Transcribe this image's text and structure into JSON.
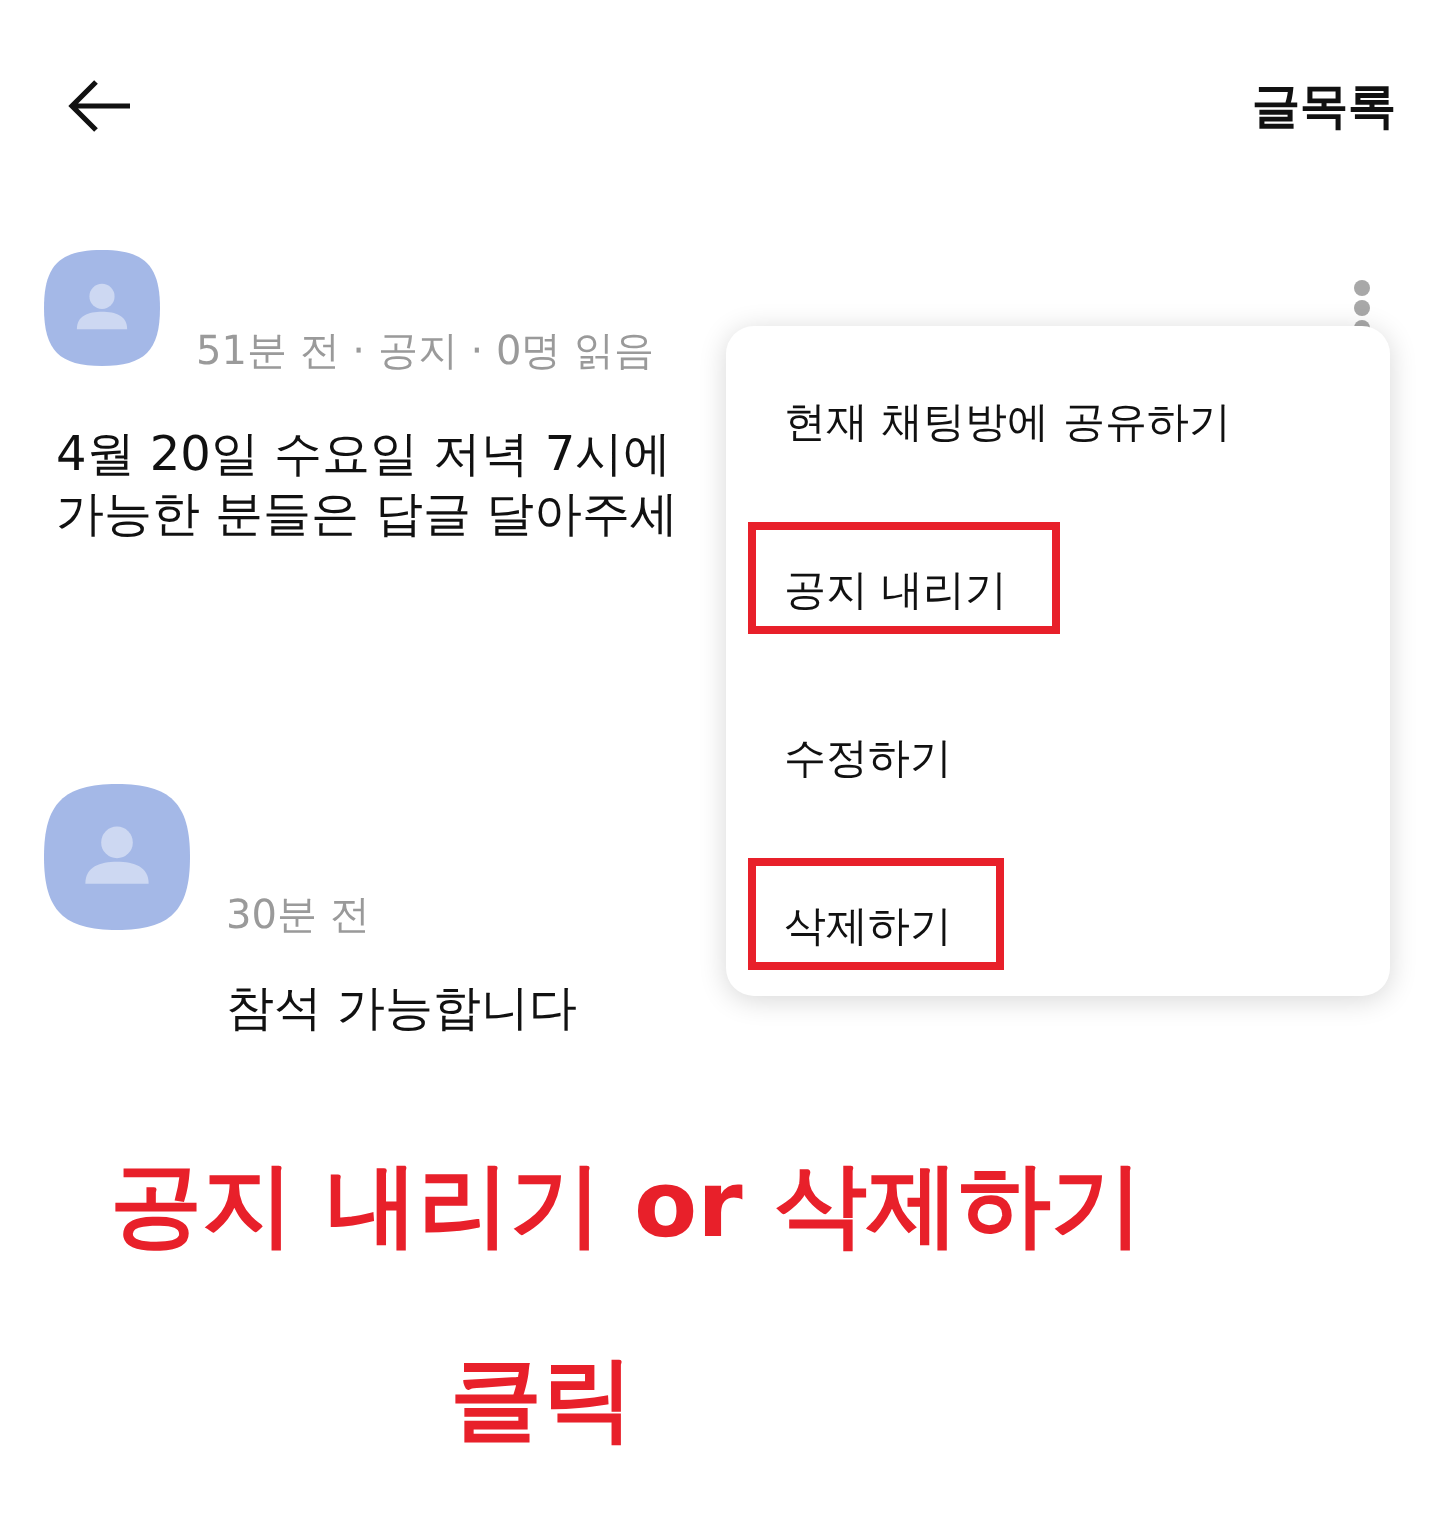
{
  "header": {
    "list_button": "글목록"
  },
  "post": {
    "meta": "51분 전 · 공지 · 0명 읽음",
    "body_lines": [
      "4월 20일 수요일 저녁 7시에",
      "가능한 분들은 답글 달아주세"
    ]
  },
  "reply": {
    "meta": "30분 전",
    "body": "참석 가능합니다"
  },
  "menu": {
    "items": [
      {
        "label": "현재 채팅방에 공유하기",
        "highlighted": false
      },
      {
        "label": "공지 내리기",
        "highlighted": true
      },
      {
        "label": "수정하기",
        "highlighted": false
      },
      {
        "label": "삭제하기",
        "highlighted": true
      }
    ]
  },
  "annotation": {
    "lines": [
      "공지 내리기 or 삭제하기",
      "클릭"
    ]
  }
}
